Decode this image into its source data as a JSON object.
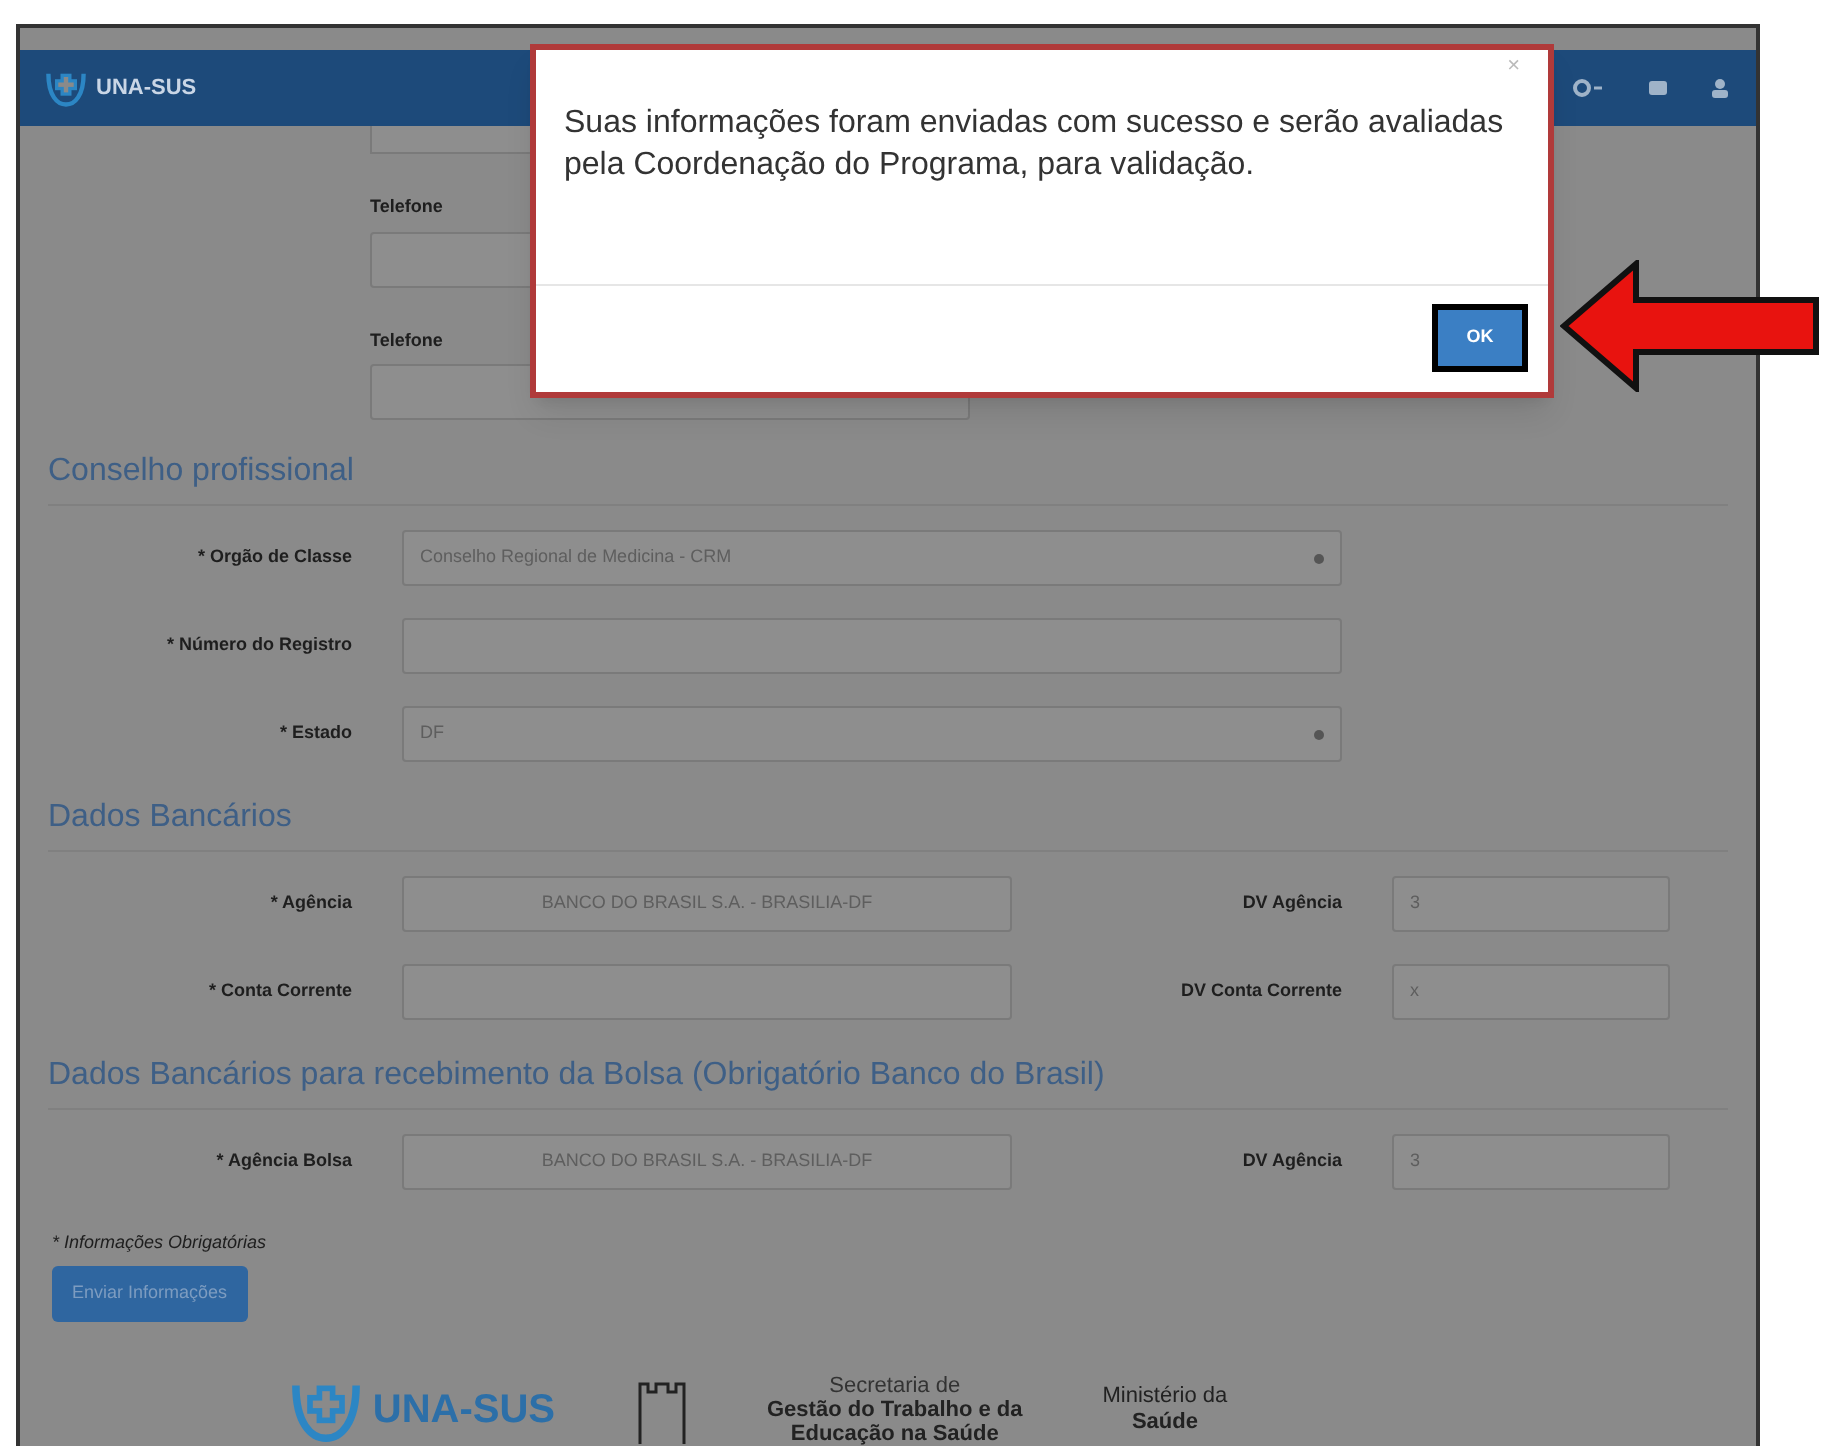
{
  "header": {
    "logo_text": "UNA-SUS"
  },
  "contact": {
    "fields": [
      {
        "label": "Telefone"
      },
      {
        "label": "Telefone"
      }
    ]
  },
  "sections": [
    {
      "title": "Conselho profissional",
      "rows": [
        {
          "kind": "select",
          "label": "* Orgão de Classe",
          "value": "Conselho Regional de Medicina - CRM"
        },
        {
          "kind": "text",
          "label": "* Número do Registro"
        },
        {
          "kind": "select",
          "label": "* Estado",
          "value": "DF"
        }
      ]
    },
    {
      "title": "Dados Bancários",
      "rows": [
        {
          "kind": "split",
          "label": "* Agência",
          "value": "BANCO DO BRASIL S.A. - BRASILIA-DF",
          "side_label": "DV Agência",
          "side_value": "3"
        },
        {
          "kind": "split",
          "label": "* Conta Corrente",
          "side_label": "DV Conta Corrente",
          "side_value": "x"
        }
      ]
    },
    {
      "title": "Dados Bancários para recebimento da Bolsa (Obrigatório Banco do Brasil)",
      "rows": [
        {
          "kind": "split",
          "label": "* Agência Bolsa",
          "value": "BANCO DO BRASIL S.A. - BRASILIA-DF",
          "side_label": "DV Agência",
          "side_value": "3"
        }
      ]
    }
  ],
  "required_note": "* Informações Obrigatórias",
  "submit_button": "Enviar Informações",
  "footer": {
    "unasus": "UNA-SUS",
    "secretaria": [
      "Secretaria de",
      "Gestão do Trabalho e da",
      "Educação na Saúde"
    ],
    "ministerio": [
      "Ministério da",
      "Saúde"
    ]
  },
  "modal": {
    "message": "Suas informações foram enviadas com sucesso e serão avaliadas pela Coordenação do Programa, para validação.",
    "close": "×",
    "ok_button": "OK"
  }
}
